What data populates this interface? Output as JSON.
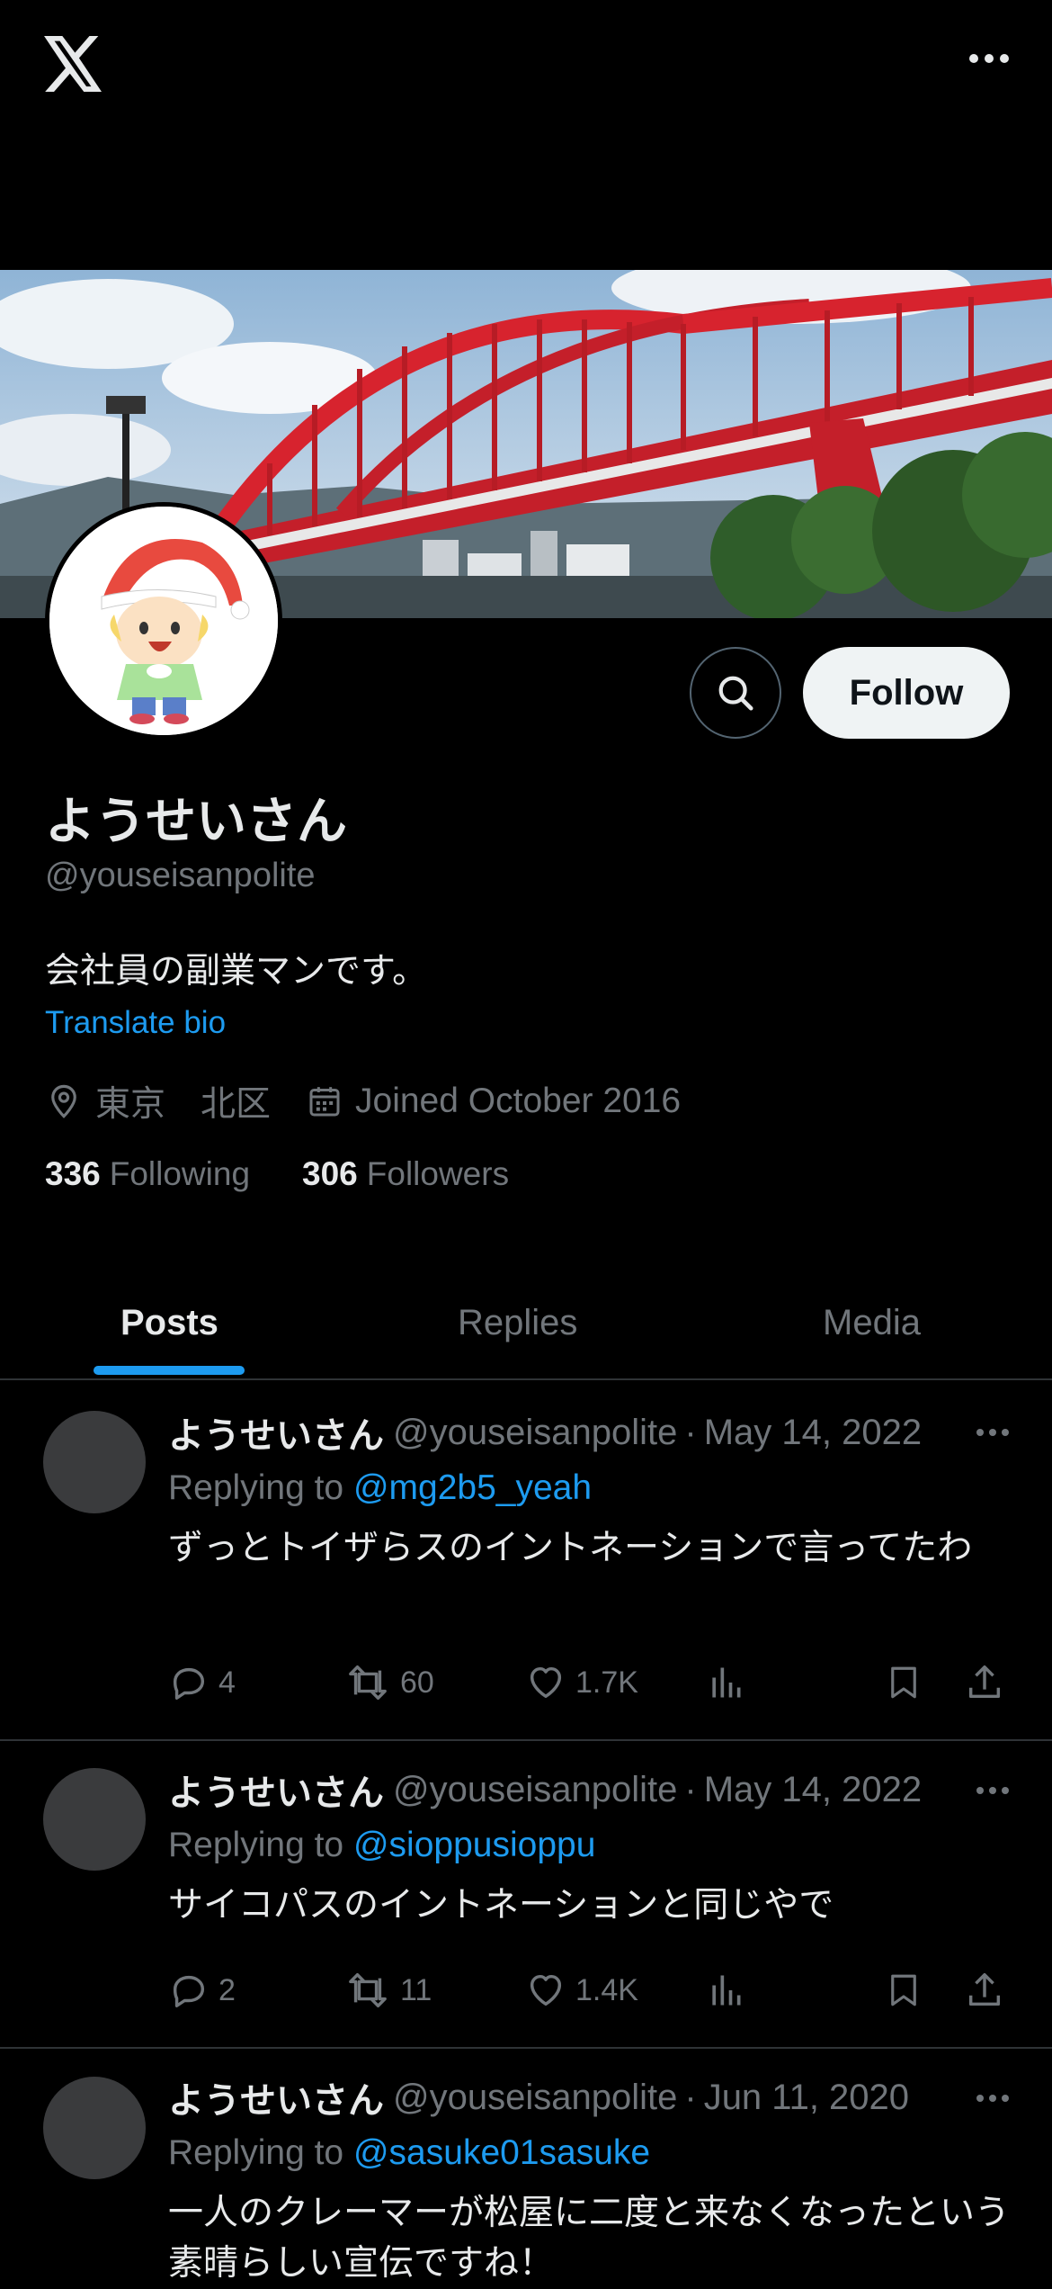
{
  "topbar": {
    "logo_icon": "x-logo-icon",
    "more_icon": "more-horizontal-icon"
  },
  "profile": {
    "name": "ようせいさん",
    "handle": "@youseisanpolite",
    "bio": "会社員の副業マンです。",
    "translate_label": "Translate bio",
    "location": "東京　北区",
    "joined": "Joined October 2016",
    "following_count": "336",
    "following_label": "Following",
    "followers_count": "306",
    "followers_label": "Followers",
    "follow_label": "Follow"
  },
  "tabs": [
    {
      "label": "Posts",
      "active": true
    },
    {
      "label": "Replies",
      "active": false
    },
    {
      "label": "Media",
      "active": false
    }
  ],
  "posts": [
    {
      "name": "ようせいさん",
      "handle": "@youseisanpolite",
      "date": "May 14, 2022",
      "replying_prefix": "Replying to",
      "replying_to": "@mg2b5_yeah",
      "text": "ずっとトイザらスのイントネーションで言ってたわ",
      "replies": "4",
      "reposts": "60",
      "likes": "1.7K"
    },
    {
      "name": "ようせいさん",
      "handle": "@youseisanpolite",
      "date": "May 14, 2022",
      "replying_prefix": "Replying to",
      "replying_to": "@sioppusioppu",
      "text": "サイコパスのイントネーションと同じやで",
      "replies": "2",
      "reposts": "11",
      "likes": "1.4K"
    },
    {
      "name": "ようせいさん",
      "handle": "@youseisanpolite",
      "date": "Jun 11, 2020",
      "replying_prefix": "Replying to",
      "replying_to": "@sasuke01sasuke",
      "text": "一人のクレーマーが松屋に二度と来なくなったという素晴らしい宣伝ですね！",
      "replies": "",
      "reposts": "",
      "likes": ""
    }
  ],
  "colors": {
    "accent": "#1d9bf0",
    "muted": "#71767b",
    "bridge": "#d7232e"
  }
}
